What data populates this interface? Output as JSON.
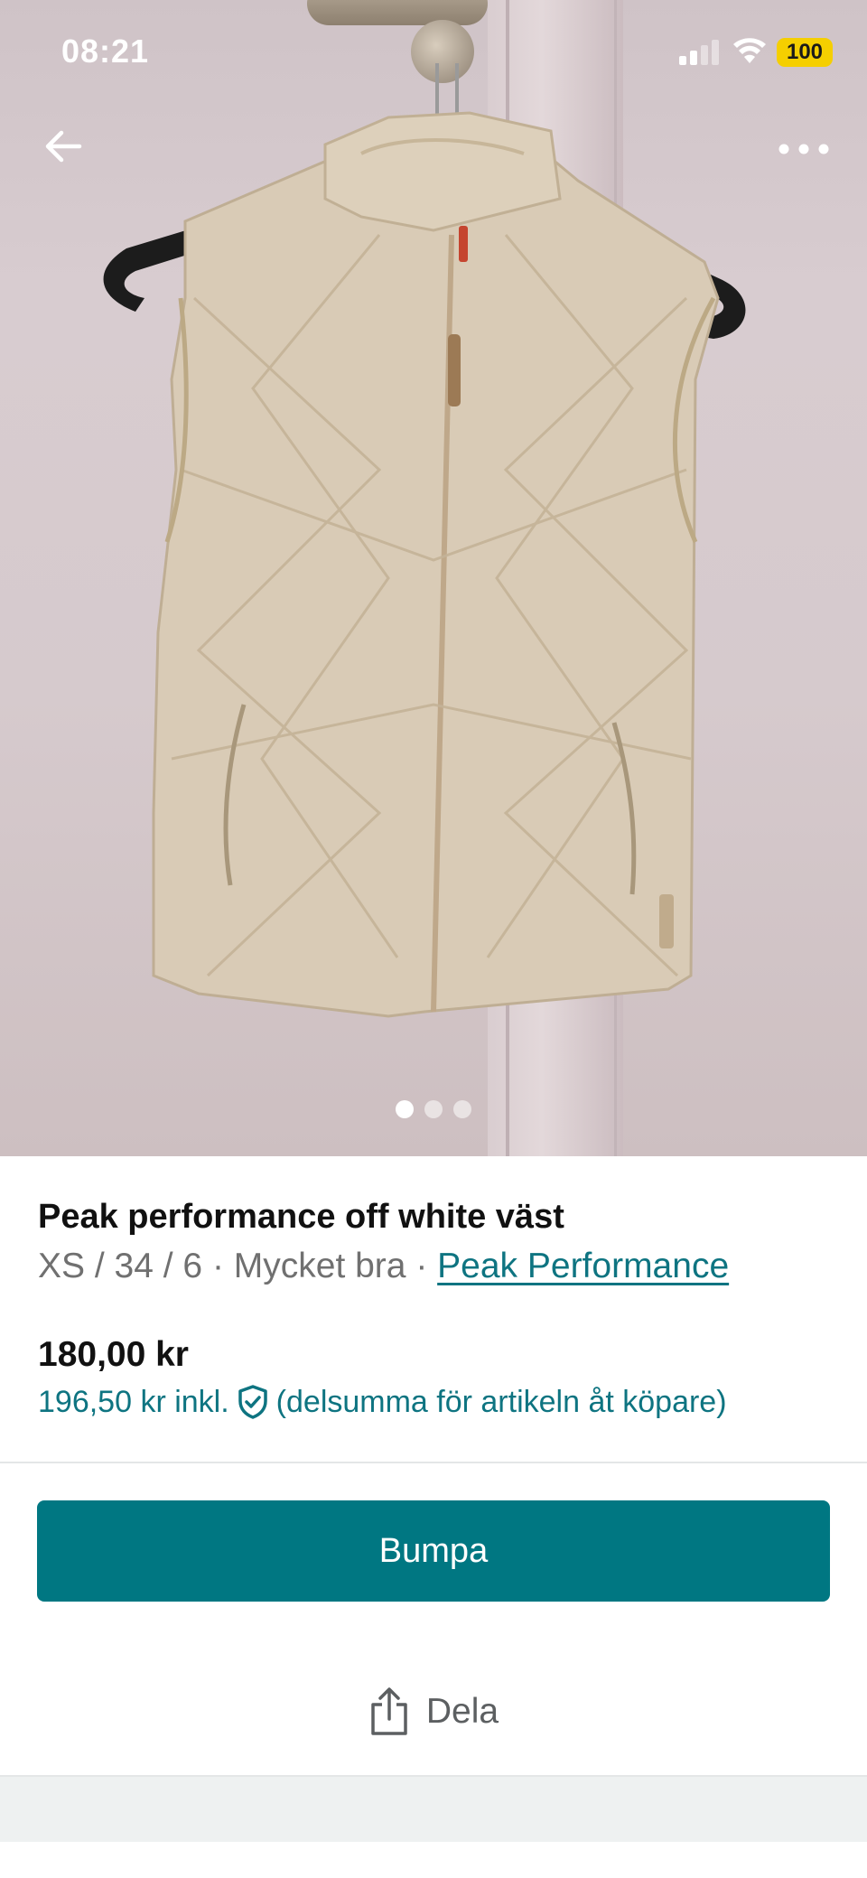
{
  "status_bar": {
    "time": "08:21",
    "battery": "100",
    "icons": [
      "signal-icon",
      "wifi-icon",
      "battery-icon"
    ]
  },
  "nav": {
    "back_icon": "arrow-left-icon",
    "more_icon": "more-horizontal-icon"
  },
  "gallery": {
    "photo_count": 3,
    "active_index": 0
  },
  "item": {
    "title": "Peak performance off white väst",
    "meta_prefix": "XS / 34 / 6 · Mycket bra · ",
    "brand": "Peak Performance",
    "price": "180,00 kr",
    "price_incl": "196,50 kr inkl.",
    "price_incl_note": "(delsumma för artikeln åt köpare)"
  },
  "actions": {
    "bump_label": "Bumpa",
    "share_label": "Dela"
  },
  "colors": {
    "accent": "#007782",
    "link": "#0e7481",
    "text": "#111111",
    "muted": "#707070",
    "battery": "#f5cf00"
  }
}
